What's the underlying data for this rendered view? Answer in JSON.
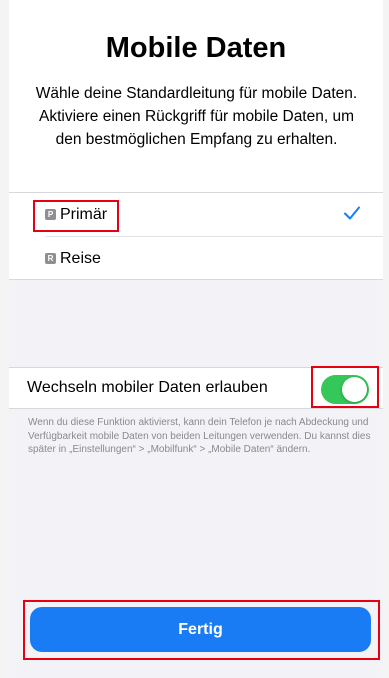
{
  "page": {
    "title": "Mobile Daten",
    "subtitle": "Wähle deine Standardleitung für mobile Daten. Aktiviere einen Rückgriff für mobile Daten, um den bestmöglichen Empfang zu erhalten."
  },
  "lines": [
    {
      "badge": "P",
      "label": "Primär",
      "selected": true,
      "icon": "checkmark-icon"
    },
    {
      "badge": "R",
      "label": "Reise",
      "selected": false
    }
  ],
  "toggle": {
    "label": "Wechseln mobiler Daten erlauben",
    "on": true,
    "on_color": "#34c759"
  },
  "footer_note": "Wenn du diese Funktion aktivierst, kann dein Telefon je nach Abdeckung und Verfügbarkeit mobile Daten von beiden Leitungen verwenden. Du kannst dies später in „Einstellungen“ > „Mobilfunk“ > „Mobile Daten“ ändern.",
  "buttons": {
    "done_label": "Fertig"
  },
  "colors": {
    "accent": "#1a7cf5",
    "highlight": "#e60012",
    "background": "#f2f2f7"
  }
}
